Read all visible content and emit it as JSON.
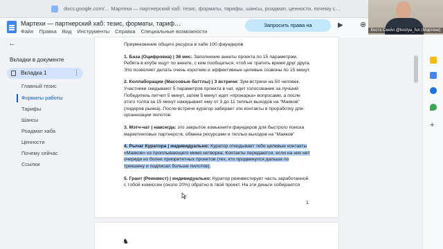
{
  "browser": {
    "url": "docs.google.com/…   Мартехи — партнерский хаб: тезис, форматы, тарифы, шансы, роадмап, ценности, почему с…"
  },
  "header": {
    "title": "Мартехи — партнерский хаб: тезис, форматы, тариф…",
    "menu": [
      "Файл",
      "Правка",
      "Вид",
      "Инструменты",
      "Справка",
      "Специальные возможности"
    ],
    "request_button": "Запросить права на редактирование"
  },
  "webcam": {
    "label": "Костя Скейл @kostya_fun (Мартехи)"
  },
  "sidebar": {
    "heading": "Вкладки в документе",
    "tab_label": "Вкладка 1",
    "outline": [
      "Главный тезис",
      "Форматы работы",
      "Тарифы",
      "Шансы",
      "Роадмап хаба",
      "Ценности",
      "Почему сейчас",
      "Ссылки"
    ]
  },
  "document": {
    "intro": "Приумножение общего ресурса в хабе 100 фаундеров",
    "item1_title": "1. База (Оцифровка) | 36 мес:",
    "item1_text": " Заполнение анкеты проекта по 15 параметрам. Ребята в клубе ищут по анкете, с кем пообщаться, чтоб не тратить время друг друга. Это позволяет делать очень короткие и эффективные целевые созвоны по 15 минут.",
    "item2_title": "2. Коллаборации (Массовые баттлы) | 3 встречи:",
    "item2_text": " Зум-встречи на 50 человек. Участники скидывают 5 параметров проекта в чат, идет голосование за лучший. Победитель питчит 5 минут, затем 5 минут идет «прожарка» вопросами, а после этого толпа за 15 минут накидывает ему от 3 до 11 теплых выходов на “Маяков” (лидеров рынка). После встречи куратор забирает эти контакты в проработку для организации пилотов.",
    "item3_title": "3. Мэтч-чат | навсегда:",
    "item3_text": " это закрытое комьюнити фаундеров для быстрого поиска маркетинговых партнерств, обмена ресурсами и теплых выходов на “Маяков”",
    "item4_title": "4. Рычаг Куратора | индивидуально:",
    "item4_text": " Куратор откидывает тебе целевые контакты «Маяков» из проплывающего мимо нетворка. Контакты передаются, если на них нет очереди из более приоритетных проектов (тех, кто продвинулся дальше по трекшену и подписал больше пилотов).",
    "item5_title": "5. Грант (Реинвест) | индивидуально:",
    "item5_text": " Куратор реинвестирует часть заработанной с тобой комиссии (около 20%) обратно в твой проект. На эти деньги собираются",
    "page_number": "1"
  }
}
